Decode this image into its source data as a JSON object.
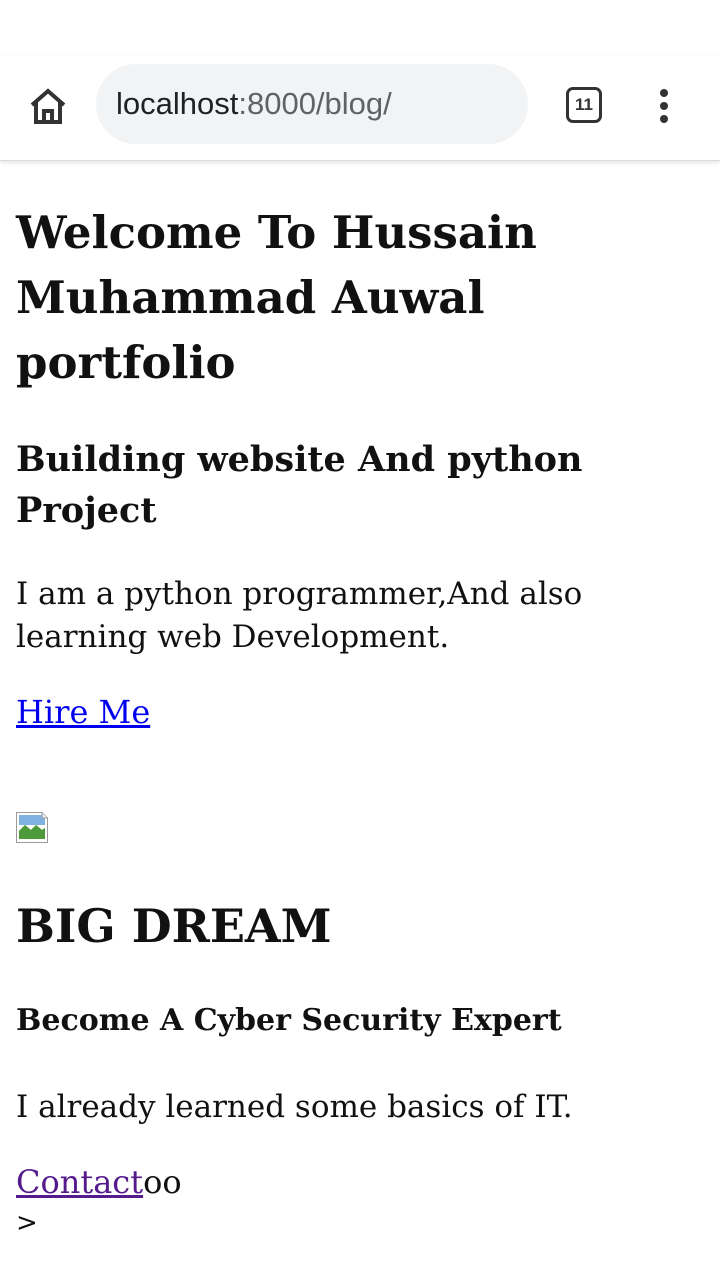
{
  "browser": {
    "url_host": "localhost",
    "url_rest": ":8000/blog/",
    "tab_count": "11",
    "icons": {
      "home": "home-icon",
      "tabs": "tab-switcher-icon",
      "menu": "more-vert-icon"
    }
  },
  "page": {
    "title": "Welcome To Hussain Muhammad Auwal portfolio",
    "subtitle": "Building website And python Project",
    "intro": "I am a python programmer,And also learning web Development.",
    "hire_link": "Hire Me",
    "image": "broken-image-icon",
    "dream_title": "BIG DREAM",
    "dream_subtitle": "Become A Cyber Security Expert",
    "dream_text": "I already learned some basics of IT.",
    "contact_link": "Contact",
    "contact_trailing": "oo",
    "stray_text": ">"
  },
  "colors": {
    "link": "#0000ee",
    "visited_link": "#551a8b",
    "url_bar_bg": "#f1f3f4"
  }
}
